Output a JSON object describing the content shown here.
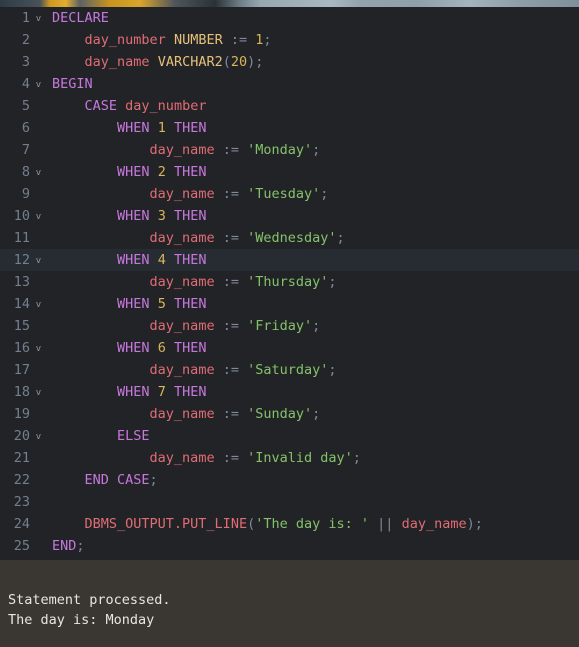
{
  "editor": {
    "name": "sql-code-editor",
    "language": "PL/SQL",
    "active_line": 12,
    "colors": {
      "background": "#222326",
      "active_line": "#272c33",
      "line_number": "#737f90",
      "keyword": "#c678dd",
      "identifier": "#e06c75",
      "type": "#e5c07b",
      "number": "#d9b55b",
      "string": "#84c26a",
      "operator": "#7d8a9c",
      "output_background": "#3a3733",
      "output_text": "#e8e6e1"
    },
    "fold_marker_glyph": "v",
    "lines": [
      {
        "n": "1",
        "fold": true,
        "tokens": [
          {
            "t": "DECLARE",
            "c": "kw"
          }
        ]
      },
      {
        "n": "2",
        "fold": false,
        "tokens": [
          {
            "t": "    ",
            "c": "op"
          },
          {
            "t": "day_number",
            "c": "id"
          },
          {
            "t": " ",
            "c": "op"
          },
          {
            "t": "NUMBER",
            "c": "typ"
          },
          {
            "t": " ",
            "c": "op"
          },
          {
            "t": ":=",
            "c": "op"
          },
          {
            "t": " ",
            "c": "op"
          },
          {
            "t": "1",
            "c": "num"
          },
          {
            "t": ";",
            "c": "op"
          }
        ]
      },
      {
        "n": "3",
        "fold": false,
        "tokens": [
          {
            "t": "    ",
            "c": "op"
          },
          {
            "t": "day_name",
            "c": "id"
          },
          {
            "t": " ",
            "c": "op"
          },
          {
            "t": "VARCHAR2",
            "c": "typ"
          },
          {
            "t": "(",
            "c": "op"
          },
          {
            "t": "20",
            "c": "num"
          },
          {
            "t": ");",
            "c": "op"
          }
        ]
      },
      {
        "n": "4",
        "fold": true,
        "tokens": [
          {
            "t": "BEGIN",
            "c": "kw"
          }
        ]
      },
      {
        "n": "5",
        "fold": false,
        "tokens": [
          {
            "t": "    ",
            "c": "op"
          },
          {
            "t": "CASE",
            "c": "kw"
          },
          {
            "t": " ",
            "c": "op"
          },
          {
            "t": "day_number",
            "c": "id"
          }
        ]
      },
      {
        "n": "6",
        "fold": false,
        "tokens": [
          {
            "t": "        ",
            "c": "op"
          },
          {
            "t": "WHEN",
            "c": "kw"
          },
          {
            "t": " ",
            "c": "op"
          },
          {
            "t": "1",
            "c": "num"
          },
          {
            "t": " ",
            "c": "op"
          },
          {
            "t": "THEN",
            "c": "kw"
          }
        ]
      },
      {
        "n": "7",
        "fold": false,
        "tokens": [
          {
            "t": "            ",
            "c": "op"
          },
          {
            "t": "day_name",
            "c": "id"
          },
          {
            "t": " ",
            "c": "op"
          },
          {
            "t": ":=",
            "c": "op"
          },
          {
            "t": " ",
            "c": "op"
          },
          {
            "t": "'Monday'",
            "c": "str"
          },
          {
            "t": ";",
            "c": "op"
          }
        ]
      },
      {
        "n": "8",
        "fold": true,
        "tokens": [
          {
            "t": "        ",
            "c": "op"
          },
          {
            "t": "WHEN",
            "c": "kw"
          },
          {
            "t": " ",
            "c": "op"
          },
          {
            "t": "2",
            "c": "num"
          },
          {
            "t": " ",
            "c": "op"
          },
          {
            "t": "THEN",
            "c": "kw"
          }
        ]
      },
      {
        "n": "9",
        "fold": false,
        "tokens": [
          {
            "t": "            ",
            "c": "op"
          },
          {
            "t": "day_name",
            "c": "id"
          },
          {
            "t": " ",
            "c": "op"
          },
          {
            "t": ":=",
            "c": "op"
          },
          {
            "t": " ",
            "c": "op"
          },
          {
            "t": "'Tuesday'",
            "c": "str"
          },
          {
            "t": ";",
            "c": "op"
          }
        ]
      },
      {
        "n": "10",
        "fold": true,
        "tokens": [
          {
            "t": "        ",
            "c": "op"
          },
          {
            "t": "WHEN",
            "c": "kw"
          },
          {
            "t": " ",
            "c": "op"
          },
          {
            "t": "3",
            "c": "num"
          },
          {
            "t": " ",
            "c": "op"
          },
          {
            "t": "THEN",
            "c": "kw"
          }
        ]
      },
      {
        "n": "11",
        "fold": false,
        "tokens": [
          {
            "t": "            ",
            "c": "op"
          },
          {
            "t": "day_name",
            "c": "id"
          },
          {
            "t": " ",
            "c": "op"
          },
          {
            "t": ":=",
            "c": "op"
          },
          {
            "t": " ",
            "c": "op"
          },
          {
            "t": "'Wednesday'",
            "c": "str"
          },
          {
            "t": ";",
            "c": "op"
          }
        ]
      },
      {
        "n": "12",
        "fold": true,
        "active": true,
        "tokens": [
          {
            "t": "        ",
            "c": "op"
          },
          {
            "t": "WHEN",
            "c": "kw"
          },
          {
            "t": " ",
            "c": "op"
          },
          {
            "t": "4",
            "c": "num"
          },
          {
            "t": " ",
            "c": "op"
          },
          {
            "t": "THEN",
            "c": "kw"
          }
        ]
      },
      {
        "n": "13",
        "fold": false,
        "tokens": [
          {
            "t": "            ",
            "c": "op"
          },
          {
            "t": "day_name",
            "c": "id"
          },
          {
            "t": " ",
            "c": "op"
          },
          {
            "t": ":=",
            "c": "op"
          },
          {
            "t": " ",
            "c": "op"
          },
          {
            "t": "'Thursday'",
            "c": "str"
          },
          {
            "t": ";",
            "c": "op"
          }
        ]
      },
      {
        "n": "14",
        "fold": true,
        "tokens": [
          {
            "t": "        ",
            "c": "op"
          },
          {
            "t": "WHEN",
            "c": "kw"
          },
          {
            "t": " ",
            "c": "op"
          },
          {
            "t": "5",
            "c": "num"
          },
          {
            "t": " ",
            "c": "op"
          },
          {
            "t": "THEN",
            "c": "kw"
          }
        ]
      },
      {
        "n": "15",
        "fold": false,
        "tokens": [
          {
            "t": "            ",
            "c": "op"
          },
          {
            "t": "day_name",
            "c": "id"
          },
          {
            "t": " ",
            "c": "op"
          },
          {
            "t": ":=",
            "c": "op"
          },
          {
            "t": " ",
            "c": "op"
          },
          {
            "t": "'Friday'",
            "c": "str"
          },
          {
            "t": ";",
            "c": "op"
          }
        ]
      },
      {
        "n": "16",
        "fold": true,
        "tokens": [
          {
            "t": "        ",
            "c": "op"
          },
          {
            "t": "WHEN",
            "c": "kw"
          },
          {
            "t": " ",
            "c": "op"
          },
          {
            "t": "6",
            "c": "num"
          },
          {
            "t": " ",
            "c": "op"
          },
          {
            "t": "THEN",
            "c": "kw"
          }
        ]
      },
      {
        "n": "17",
        "fold": false,
        "tokens": [
          {
            "t": "            ",
            "c": "op"
          },
          {
            "t": "day_name",
            "c": "id"
          },
          {
            "t": " ",
            "c": "op"
          },
          {
            "t": ":=",
            "c": "op"
          },
          {
            "t": " ",
            "c": "op"
          },
          {
            "t": "'Saturday'",
            "c": "str"
          },
          {
            "t": ";",
            "c": "op"
          }
        ]
      },
      {
        "n": "18",
        "fold": true,
        "tokens": [
          {
            "t": "        ",
            "c": "op"
          },
          {
            "t": "WHEN",
            "c": "kw"
          },
          {
            "t": " ",
            "c": "op"
          },
          {
            "t": "7",
            "c": "num"
          },
          {
            "t": " ",
            "c": "op"
          },
          {
            "t": "THEN",
            "c": "kw"
          }
        ]
      },
      {
        "n": "19",
        "fold": false,
        "tokens": [
          {
            "t": "            ",
            "c": "op"
          },
          {
            "t": "day_name",
            "c": "id"
          },
          {
            "t": " ",
            "c": "op"
          },
          {
            "t": ":=",
            "c": "op"
          },
          {
            "t": " ",
            "c": "op"
          },
          {
            "t": "'Sunday'",
            "c": "str"
          },
          {
            "t": ";",
            "c": "op"
          }
        ]
      },
      {
        "n": "20",
        "fold": true,
        "tokens": [
          {
            "t": "        ",
            "c": "op"
          },
          {
            "t": "ELSE",
            "c": "kw"
          }
        ]
      },
      {
        "n": "21",
        "fold": false,
        "tokens": [
          {
            "t": "            ",
            "c": "op"
          },
          {
            "t": "day_name",
            "c": "id"
          },
          {
            "t": " ",
            "c": "op"
          },
          {
            "t": ":=",
            "c": "op"
          },
          {
            "t": " ",
            "c": "op"
          },
          {
            "t": "'Invalid day'",
            "c": "str"
          },
          {
            "t": ";",
            "c": "op"
          }
        ]
      },
      {
        "n": "22",
        "fold": false,
        "tokens": [
          {
            "t": "    ",
            "c": "op"
          },
          {
            "t": "END CASE",
            "c": "kw"
          },
          {
            "t": ";",
            "c": "op"
          }
        ]
      },
      {
        "n": "23",
        "fold": false,
        "tokens": []
      },
      {
        "n": "24",
        "fold": false,
        "tokens": [
          {
            "t": "    ",
            "c": "op"
          },
          {
            "t": "DBMS_OUTPUT.PUT_LINE",
            "c": "id"
          },
          {
            "t": "(",
            "c": "op"
          },
          {
            "t": "'The day is: '",
            "c": "str"
          },
          {
            "t": " ",
            "c": "op"
          },
          {
            "t": "||",
            "c": "op"
          },
          {
            "t": " ",
            "c": "op"
          },
          {
            "t": "day_name",
            "c": "id"
          },
          {
            "t": ");",
            "c": "op"
          }
        ]
      },
      {
        "n": "25",
        "fold": false,
        "tokens": [
          {
            "t": "END",
            "c": "kw"
          },
          {
            "t": ";",
            "c": "op"
          }
        ]
      }
    ]
  },
  "output_panel": {
    "name": "script-output",
    "lines": [
      "Statement processed.",
      "The day is: Monday"
    ]
  }
}
